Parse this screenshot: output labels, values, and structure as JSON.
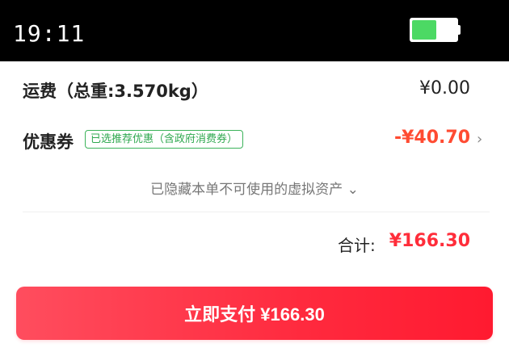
{
  "status_bar": {
    "time": "19:11",
    "battery_level": 0.55,
    "battery_color": "#4cd964"
  },
  "shipping": {
    "label": "运费（总重:3.570kg）",
    "value": "¥0.00"
  },
  "coupon": {
    "label": "优惠券",
    "tag": "已选推荐优惠（含政府消费券）",
    "value": "-¥40.70",
    "chevron": "›"
  },
  "hidden_assets": {
    "text": "已隐藏本单不可使用的虚拟资产",
    "chevron": "⌄"
  },
  "total": {
    "label": "合计:",
    "value": "¥166.30"
  },
  "pay_button": {
    "label": "立即支付 ¥166.30"
  },
  "colors": {
    "accent_red": "#ff2d3a",
    "discount_red": "#ff4b32",
    "tag_green": "#3cb35a"
  }
}
